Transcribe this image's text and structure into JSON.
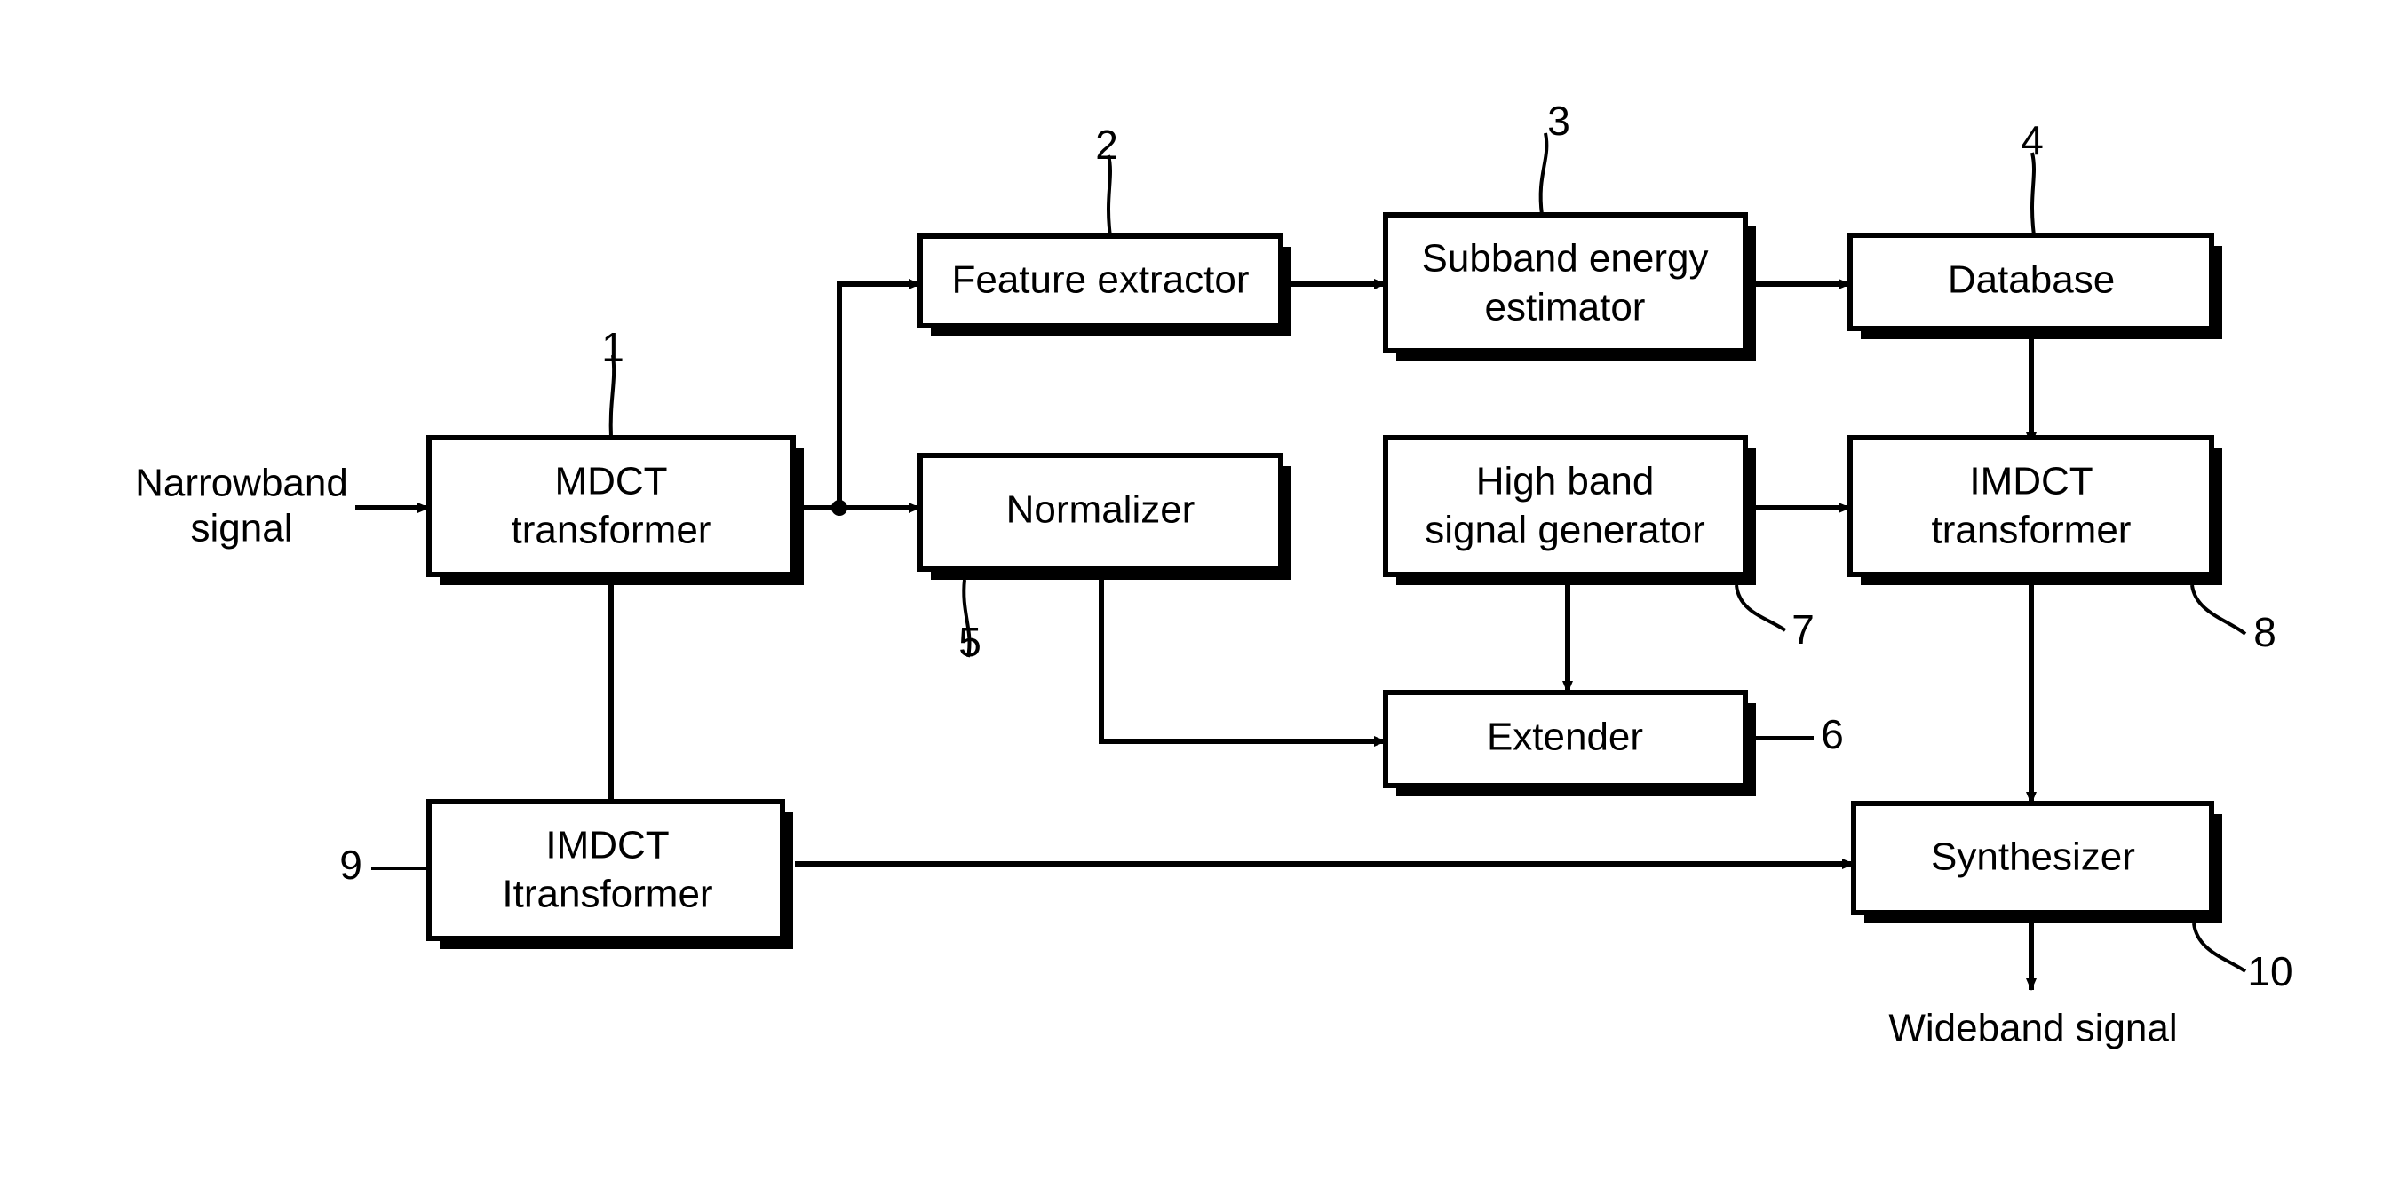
{
  "figure": {
    "type": "patent-block-diagram",
    "background_color": "#ffffff",
    "line_color": "#000000",
    "blocks": [
      {
        "id": "mdct_transformer",
        "ref": "1",
        "line1": "MDCT",
        "line2": "transformer"
      },
      {
        "id": "feature_extractor",
        "ref": "2",
        "line1": "Feature extractor",
        "line2": ""
      },
      {
        "id": "subband_energy",
        "ref": "3",
        "line1": "Subband energy",
        "line2": "estimator"
      },
      {
        "id": "database",
        "ref": "4",
        "line1": "Database",
        "line2": ""
      },
      {
        "id": "normalizer",
        "ref": "5",
        "line1": "Normalizer",
        "line2": ""
      },
      {
        "id": "extender",
        "ref": "6",
        "line1": "Extender",
        "line2": ""
      },
      {
        "id": "high_band_gen",
        "ref": "7",
        "line1": "High band",
        "line2": "signal generator"
      },
      {
        "id": "imdct_transformer",
        "ref": "8",
        "line1": "IMDCT",
        "line2": "transformer"
      },
      {
        "id": "imdct_itransformer",
        "ref": "9",
        "line1": "IMDCT",
        "line2": "Itransformer"
      },
      {
        "id": "synthesizer",
        "ref": "10",
        "line1": "Synthesizer",
        "line2": ""
      }
    ],
    "io_labels": {
      "input_line1": "Narrowband",
      "input_line2": "signal",
      "output": "Wideband signal"
    },
    "ref_numbers": {
      "mdct_transformer": "1",
      "feature_extractor": "2",
      "subband_energy": "3",
      "database": "4",
      "normalizer": "5",
      "extender": "6",
      "high_band_gen": "7",
      "imdct_transformer": "8",
      "imdct_itransformer": "9",
      "synthesizer": "10"
    }
  }
}
